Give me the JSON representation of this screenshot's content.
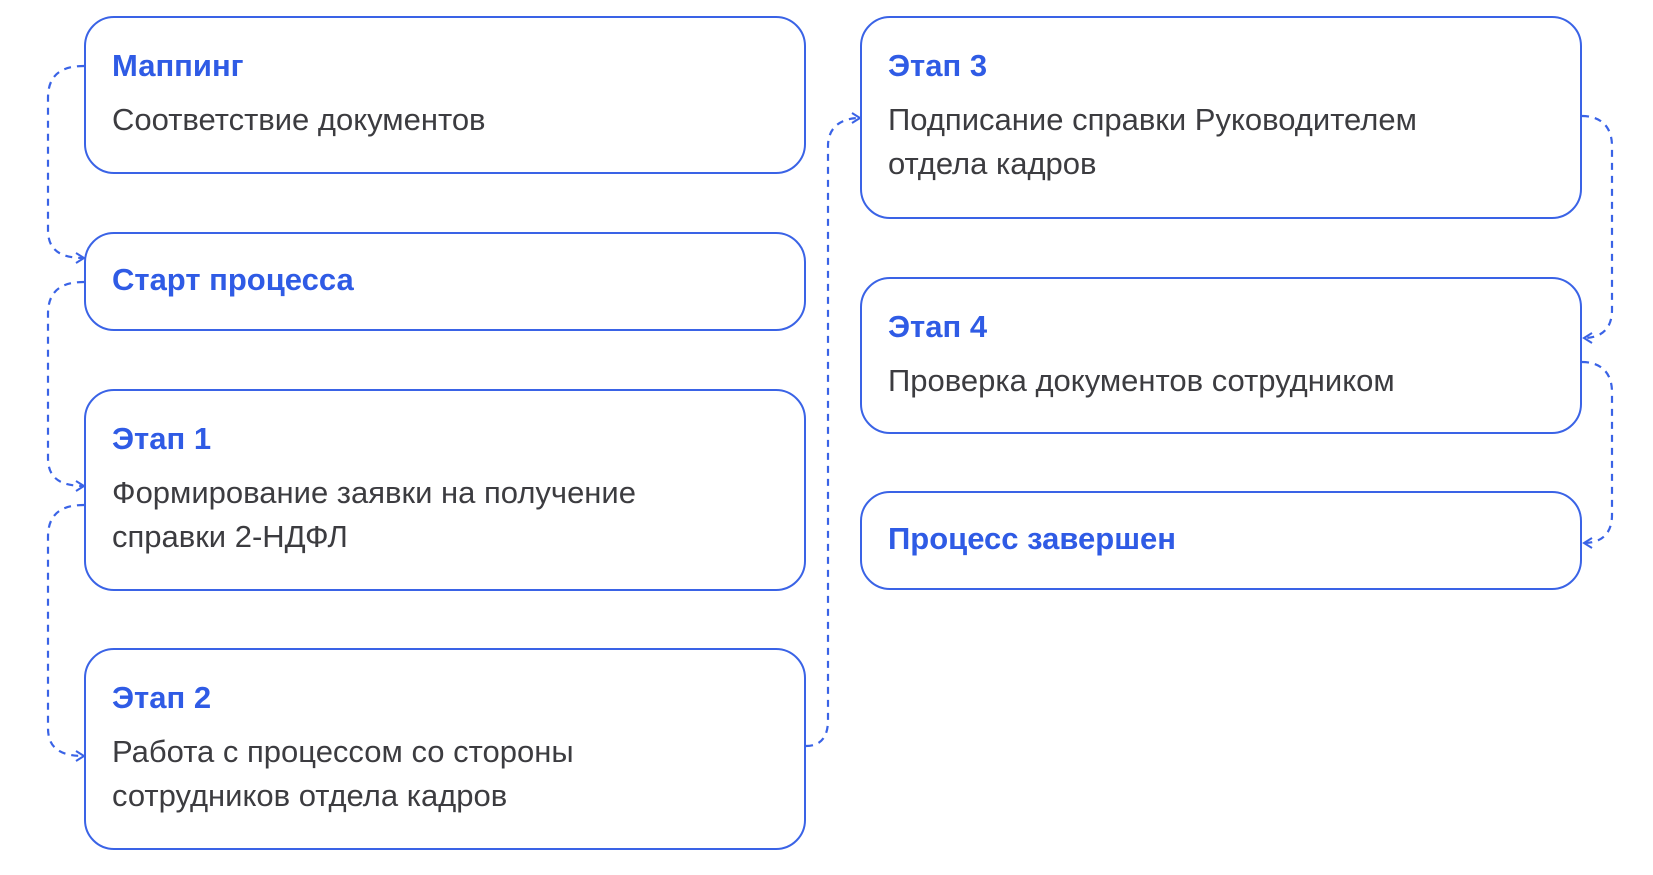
{
  "steps": {
    "mapping": {
      "title": "Маппинг",
      "desc": "Соответствие документов"
    },
    "start": {
      "title": "Старт процесса"
    },
    "stage1": {
      "title": "Этап 1",
      "desc_line1": "Формирование заявки на получение",
      "desc_line2": "справки 2-НДФЛ"
    },
    "stage2": {
      "title": "Этап 2",
      "desc_line1": "Работа с процессом со стороны",
      "desc_line2": "сотрудников отдела кадров"
    },
    "stage3": {
      "title": "Этап 3",
      "desc_line1": "Подписание справки Руководителем",
      "desc_line2": "отдела кадров"
    },
    "stage4": {
      "title": "Этап 4",
      "desc": "Проверка документов сотрудником"
    },
    "finish": {
      "title": "Процесс завершен"
    }
  },
  "colors": {
    "accent": "#2f5be5",
    "border": "#3a63e6",
    "text": "#3c3c40",
    "background": "#ffffff"
  }
}
